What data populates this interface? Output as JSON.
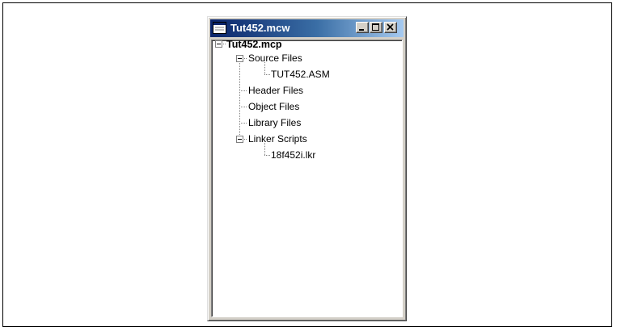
{
  "window": {
    "title": "Tut452.mcw",
    "buttons": {
      "minimize": "minimize",
      "maximize": "maximize",
      "close": "close"
    }
  },
  "tree": {
    "root": "Tut452.mcp",
    "items": [
      {
        "label": "Source Files"
      },
      {
        "label": "TUT452.ASM"
      },
      {
        "label": "Header Files"
      },
      {
        "label": "Object Files"
      },
      {
        "label": "Library Files"
      },
      {
        "label": "Linker Scripts"
      },
      {
        "label": "18f452i.lkr"
      }
    ]
  },
  "icons": {
    "app": "window-icon",
    "expanded": "minus-box-icon"
  },
  "colors": {
    "titlebar_start": "#0a246a",
    "titlebar_end": "#a6caf0",
    "window_face": "#d4d0c8"
  }
}
